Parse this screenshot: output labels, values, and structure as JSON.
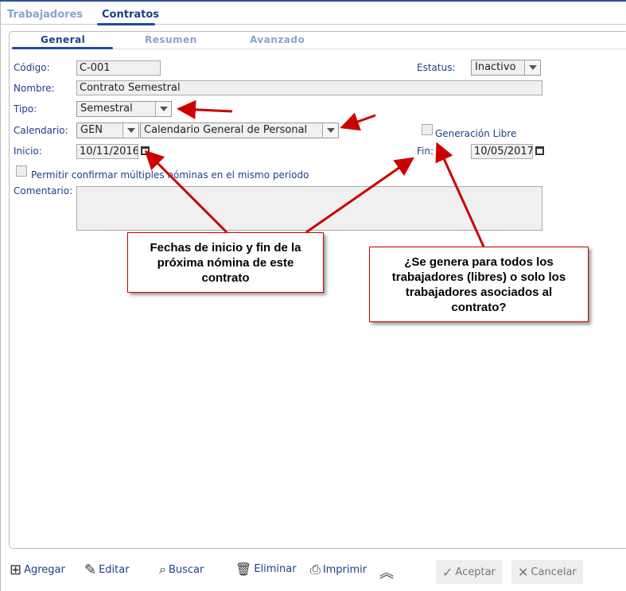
{
  "tabs": [
    {
      "label": "Trabajadores",
      "active": false
    },
    {
      "label": "Contratos",
      "active": true
    }
  ],
  "subtabs": [
    {
      "label": "General",
      "active": true
    },
    {
      "label": "Resumen",
      "active": false
    },
    {
      "label": "Avanzado",
      "active": false
    }
  ],
  "form": {
    "codigo_label": "Código:",
    "codigo": "C-001",
    "estatus_label": "Estatus:",
    "estatus": "Inactivo",
    "nombre_label": "Nombre:",
    "nombre": "Contrato Semestral",
    "tipo_label": "Tipo:",
    "tipo": "Semestral",
    "calendario_label": "Calendario:",
    "calendario_code": "GEN",
    "calendario_name": "Calendario General de Personal",
    "generacion_libre_label": "Generación Libre",
    "generacion_libre": false,
    "inicio_label": "Inicio:",
    "inicio": "10/11/2016",
    "fin_label": "Fin:",
    "fin": "10/05/2017",
    "permitir_label": "Permitir confirmar múltiples nóminas en el mismo periodo",
    "permitir": false,
    "comentario_label": "Comentario:",
    "comentario": ""
  },
  "callouts": [
    "Fechas de inicio y fin de la próxima nómina de este contrato",
    "¿Se genera para todos los trabajadores (libres) o solo los trabajadores asociados al contrato?"
  ],
  "toolbar": {
    "agregar": "Agregar",
    "editar": "Editar",
    "buscar": "Buscar",
    "eliminar": "Eliminar",
    "imprimir": "Imprimir",
    "aceptar": "Aceptar",
    "cancelar": "Cancelar"
  },
  "colors": {
    "accent": "#1d3f8a",
    "annotation": "#c00000"
  }
}
